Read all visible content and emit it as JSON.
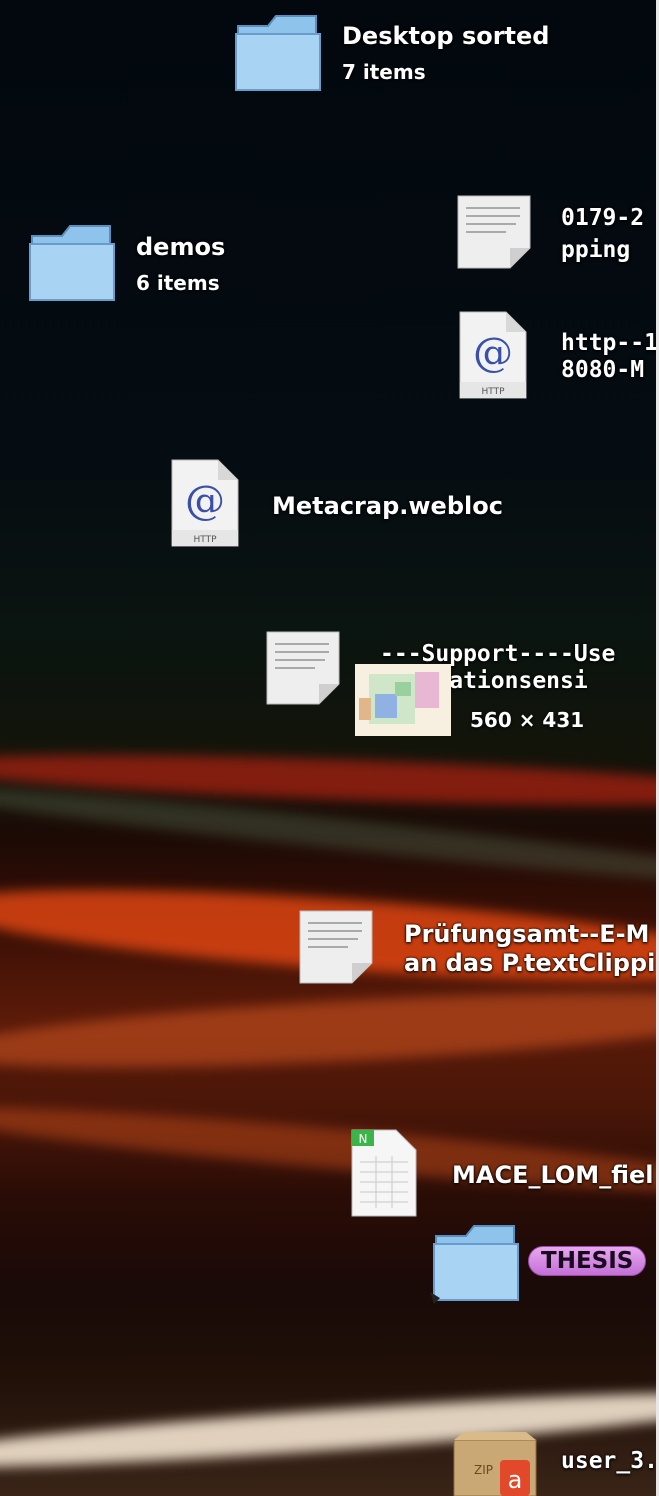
{
  "desktop": {
    "items": [
      {
        "name": "Desktop sorted",
        "subtitle": "7 items",
        "icon": "folder-icon"
      },
      {
        "name": "demos",
        "subtitle": "6 items",
        "icon": "folder-icon"
      },
      {
        "name": "0179-2",
        "name2": "pping",
        "icon": "text-clipping-icon"
      },
      {
        "name": "http--1",
        "name2": "8080-M",
        "icon": "webloc-icon"
      },
      {
        "name": "Metacrap.webloc",
        "icon": "webloc-icon"
      },
      {
        "name": "---Support----Use",
        "name2": "erlocationsensi",
        "icon": "text-clipping-icon"
      },
      {
        "dimensions": "560 × 431",
        "icon": "image-thumbnail-icon"
      },
      {
        "name": "Prüfungsamt--E-M",
        "name2": "an das P.textClippi",
        "icon": "text-clipping-icon"
      },
      {
        "name": "MACE_LOM_fiel",
        "icon": "spreadsheet-icon"
      },
      {
        "tag": "THESIS",
        "icon": "folder-icon"
      },
      {
        "name": "user_3.",
        "icon": "zip-archive-icon"
      }
    ]
  },
  "colors": {
    "folder": "#8ec3ec",
    "tag": "#d48ae4"
  }
}
